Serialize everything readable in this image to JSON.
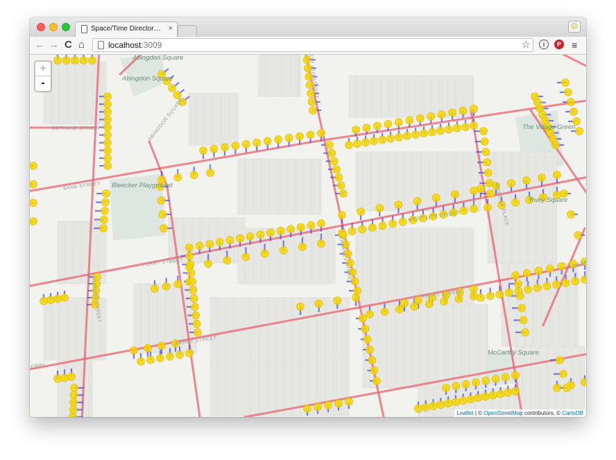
{
  "browser": {
    "tab_title": "Space/Time Directory - Str",
    "tab_close": "×",
    "url_host": "localhost",
    "url_port": ":3009",
    "back_glyph": "←",
    "forward_glyph": "→",
    "reload_glyph": "C",
    "home_glyph": "⌂",
    "star_glyph": "☆",
    "menu_glyph": "≡",
    "info_glyph": "i",
    "pinterest_glyph": "P",
    "profile_glyph": "☹"
  },
  "map": {
    "zoom_in": "+",
    "zoom_out": "-",
    "places": {
      "abingdon_top": "Abingdon Square",
      "abingdon": "Abingdon Square",
      "bleecker": "Bleecker Playground",
      "village_green": "The Village Green",
      "mccarthy": "McCarthy Square",
      "ruiry": "Ruiry Square"
    },
    "streets": {
      "bethune": "BETHUNE STREET",
      "abingdon_road": "ABINGDON SQUARE",
      "bank": "BANK STREET",
      "west4": "WEST 4TH STREET",
      "west11": "WEST 11TH STREET",
      "perry": "PERRY STREET",
      "perry_right": "PERRY STREET",
      "perry2": "PERRY STREET",
      "charles": "CHARLES STREET",
      "perry_left": "PERRY",
      "hudson": "HUDSON STREET",
      "waverly": "WAVERLY PLACE",
      "perry_far": "PERRY"
    },
    "colors": {
      "street": "#e8606e",
      "connector": "#5050ee",
      "marker": "#f5d500",
      "marker_stroke": "#e0b800",
      "park": "#dde6e0",
      "building": "#e6e6e2",
      "background": "#f2f2ef"
    },
    "attribution": {
      "leaflet": "Leaflet",
      "sep1": " | © ",
      "osm": "OpenStreetMap",
      "mid": " contributors, © ",
      "carto": "CartoDB"
    }
  }
}
